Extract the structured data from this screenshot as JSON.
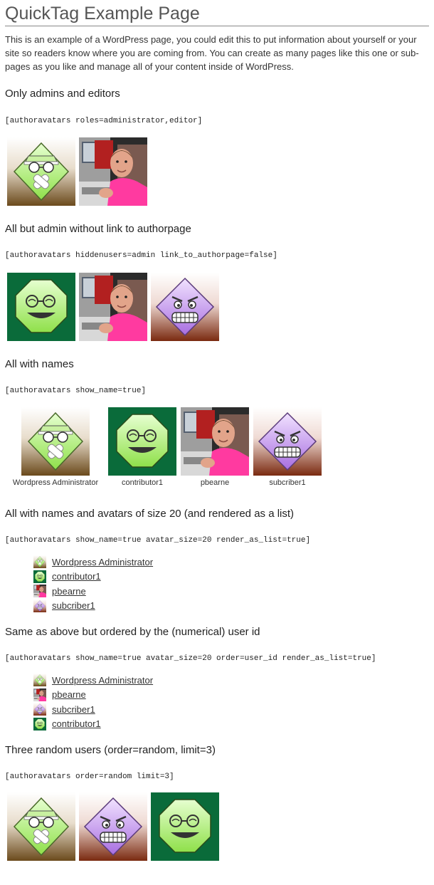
{
  "page": {
    "title": "QuickTag Example Page",
    "intro": "This is an example of a WordPress page, you could edit this to put information about yourself or your site so readers know where you are coming from. You can create as many pages like this one or sub-pages as you like and manage all of your content inside of WordPress."
  },
  "users": {
    "admin": {
      "name": "Wordpress Administrator",
      "avatar_icon": "green-diamond-bandaged-avatar-icon"
    },
    "contributor": {
      "name": "contributor1",
      "avatar_icon": "green-octagon-smiley-avatar-icon"
    },
    "pbearne": {
      "name": "pbearne",
      "avatar_icon": "man-photo-avatar-icon"
    },
    "subscriber": {
      "name": "subcriber1",
      "avatar_icon": "purple-diamond-angry-avatar-icon"
    }
  },
  "sections": [
    {
      "heading": "Only admins and editors",
      "code": "[authoravatars roles=administrator,editor]"
    },
    {
      "heading": "All but admin without link to authorpage",
      "code": "[authoravatars hiddenusers=admin link_to_authorpage=false]"
    },
    {
      "heading": "All with names",
      "code": "[authoravatars show_name=true]",
      "captions": [
        "Wordpress Administrator",
        "contributor1",
        "pbearne",
        "subcriber1"
      ]
    },
    {
      "heading": "All with names and avatars of size 20 (and rendered as a list)",
      "code": "[authoravatars show_name=true avatar_size=20 render_as_list=true]",
      "items": [
        "Wordpress Administrator",
        "contributor1",
        "pbearne",
        "subcriber1"
      ]
    },
    {
      "heading": "Same as above but ordered by the (numerical) user id",
      "code": "[authoravatars show_name=true avatar_size=20 order=user_id render_as_list=true]",
      "items": [
        "Wordpress Administrator",
        "pbearne",
        "subcriber1",
        "contributor1"
      ]
    },
    {
      "heading": "Three random users (order=random, limit=3)",
      "code": "[authoravatars order=random limit=3]"
    }
  ],
  "colors": {
    "brown_gradient_bottom": "#6b4a1c",
    "maroon_gradient_bottom": "#7a2a10",
    "green_bg": "#0a6b3a",
    "lime": "#b8f27a",
    "lavender": "#c99af0"
  }
}
